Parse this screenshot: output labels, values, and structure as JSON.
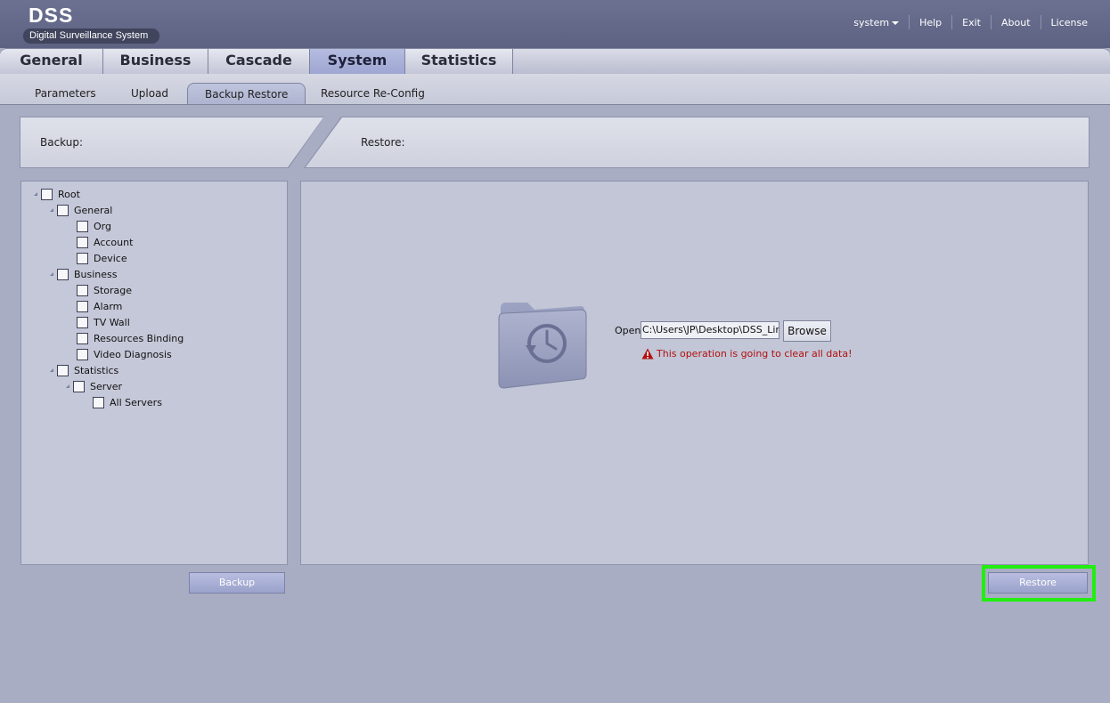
{
  "brand": {
    "title": "DSS",
    "subtitle": "Digital Surveillance System"
  },
  "top_links": {
    "user": "system",
    "help": "Help",
    "exit": "Exit",
    "about": "About",
    "license": "License"
  },
  "main_tabs": [
    {
      "label": "General"
    },
    {
      "label": "Business"
    },
    {
      "label": "Cascade"
    },
    {
      "label": "System",
      "active": true
    },
    {
      "label": "Statistics"
    }
  ],
  "sub_tabs": [
    {
      "label": "Parameters"
    },
    {
      "label": "Upload"
    },
    {
      "label": "Backup Restore",
      "active": true
    },
    {
      "label": "Resource Re-Config"
    }
  ],
  "strip": {
    "backup_label": "Backup:",
    "restore_label": "Restore:"
  },
  "tree": [
    {
      "label": "Root"
    },
    {
      "label": "General"
    },
    {
      "label": "Org"
    },
    {
      "label": "Account"
    },
    {
      "label": "Device"
    },
    {
      "label": "Business"
    },
    {
      "label": "Storage"
    },
    {
      "label": "Alarm"
    },
    {
      "label": "TV Wall"
    },
    {
      "label": "Resources Binding"
    },
    {
      "label": "Video Diagnosis"
    },
    {
      "label": "Statistics"
    },
    {
      "label": "Server"
    },
    {
      "label": "All Servers"
    }
  ],
  "restore": {
    "open_label": "Open:",
    "path_value": "C:\\Users\\JP\\Desktop\\DSS_Linux",
    "browse_label": "Browse",
    "warning": "This operation is going to clear all data!",
    "warning_color": "#b21010",
    "folder_icon": "time-machine-folder-icon"
  },
  "buttons": {
    "backup": "Backup",
    "restore": "Restore"
  },
  "colors": {
    "header": "#5d6282",
    "highlight": "#22ee11",
    "button": "#9aa1cb"
  }
}
